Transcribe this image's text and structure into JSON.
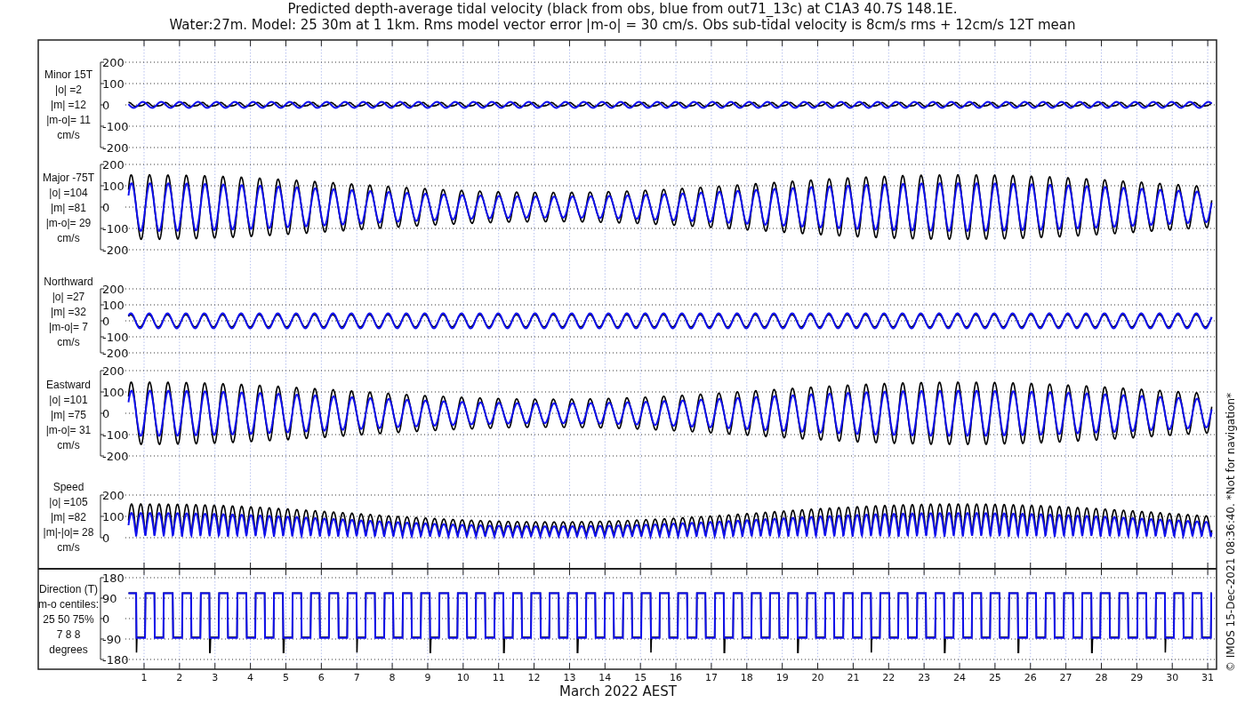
{
  "title_lines": [
    "Predicted depth-average tidal velocity (black from obs, blue from out71_13c) at C1A3 40.7S 148.1E.",
    "Water:27m. Model: 25 30m at 1 1km. Rms model vector error |m-o| = 30 cm/s. Obs sub-tidal velocity is 8cm/s rms + 12cm/s 12T mean"
  ],
  "panels": [
    {
      "kind": "minor",
      "label_lines": [
        "Minor 15T",
        "|o| =2",
        "|m| =12",
        "|m-o|= 11",
        "cm/s"
      ],
      "yticks": [
        "200",
        "100",
        "0",
        "-100",
        "-200"
      ]
    },
    {
      "kind": "major",
      "label_lines": [
        "Major -75T",
        "|o| =104",
        "|m| =81",
        "|m-o|= 29",
        "cm/s"
      ],
      "yticks": [
        "200",
        "100",
        "0",
        "-100",
        "-200"
      ]
    },
    {
      "kind": "north",
      "label_lines": [
        "Northward",
        "|o| =27",
        "|m| =32",
        "|m-o|= 7",
        "cm/s"
      ],
      "yticks": [
        "200",
        "100",
        "0",
        "-100",
        "-200"
      ]
    },
    {
      "kind": "east",
      "label_lines": [
        "Eastward",
        "|o| =101",
        "|m| =75",
        "|m-o|= 31",
        "cm/s"
      ],
      "yticks": [
        "200",
        "100",
        "0",
        "-100",
        "-200"
      ]
    },
    {
      "kind": "speed",
      "label_lines": [
        "Speed",
        "|o| =105",
        "|m| =82",
        "|m|-|o|= 28",
        "cm/s"
      ],
      "yticks": [
        "200",
        "100",
        "0"
      ]
    },
    {
      "kind": "direction",
      "label_lines": [
        "Direction (T)",
        "m-o centiles:",
        "25  50  75%",
        "7  8  8",
        "degrees"
      ],
      "yticks": [
        "180",
        "90",
        "0",
        "-90",
        "-180"
      ]
    }
  ],
  "xticks": [
    "1",
    "2",
    "3",
    "4",
    "5",
    "6",
    "7",
    "8",
    "9",
    "10",
    "11",
    "12",
    "13",
    "14",
    "15",
    "16",
    "17",
    "18",
    "19",
    "20",
    "21",
    "22",
    "23",
    "24",
    "25",
    "26",
    "27",
    "28",
    "29",
    "30",
    "31"
  ],
  "xlabel": "March 2022 AEST",
  "credit": "© IMOS 15-Dec-2021 08:36:40.  *Not for navigation*"
}
